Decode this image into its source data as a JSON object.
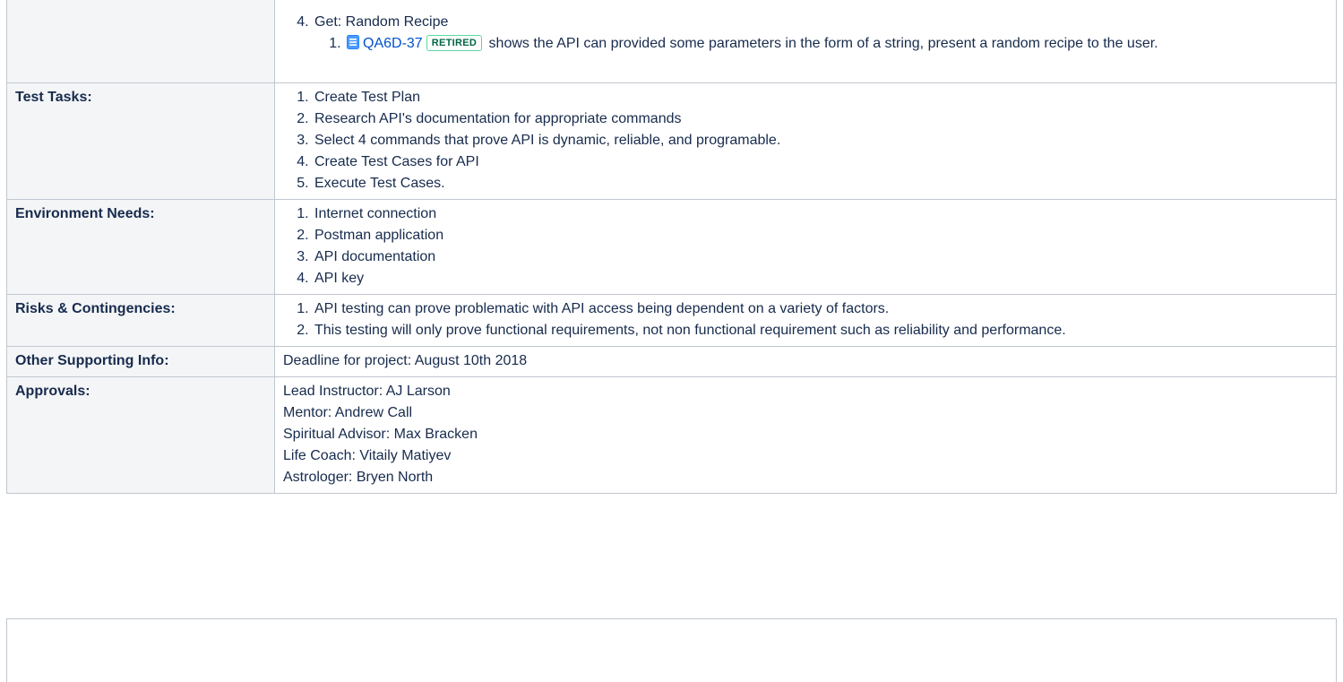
{
  "recipe_section": {
    "item_label": "Get: Random Recipe",
    "issue_key": "QA6D-37",
    "issue_status": "RETIRED",
    "issue_description": "shows the API can provided some parameters in the form of a string, present a random recipe to the user."
  },
  "rows": {
    "test_tasks": {
      "label": "Test Tasks:",
      "items": [
        "Create Test Plan",
        "Research API's documentation for appropriate commands",
        "Select 4 commands that prove API is dynamic, reliable, and programable.",
        "Create Test Cases for API",
        "Execute Test Cases."
      ]
    },
    "environment_needs": {
      "label": "Environment Needs:",
      "items": [
        "Internet connection",
        "Postman application",
        "API documentation",
        "API key"
      ]
    },
    "risks": {
      "label": "Risks & Contingencies:",
      "items": [
        "API testing can prove problematic with API access being dependent on a variety of factors.",
        "This testing will only prove functional requirements, not non functional requirement such as reliability and performance."
      ]
    },
    "other_info": {
      "label": "Other Supporting Info:",
      "text": "Deadline for project: August 10th 2018"
    },
    "approvals": {
      "label": "Approvals:",
      "lines": [
        "Lead Instructor: AJ Larson",
        "Mentor: Andrew Call",
        "Spiritual Advisor: Max Bracken",
        "Life Coach: Vitaily Matiyev",
        "Astrologer: Bryen North"
      ]
    }
  },
  "icons": {
    "issue_icon": "story-page-icon"
  },
  "colors": {
    "link": "#0052cc",
    "lozenge_border": "#57d9a3",
    "lozenge_text": "#006644",
    "label_bg": "#f4f5f7",
    "border": "#c1c7d0"
  }
}
